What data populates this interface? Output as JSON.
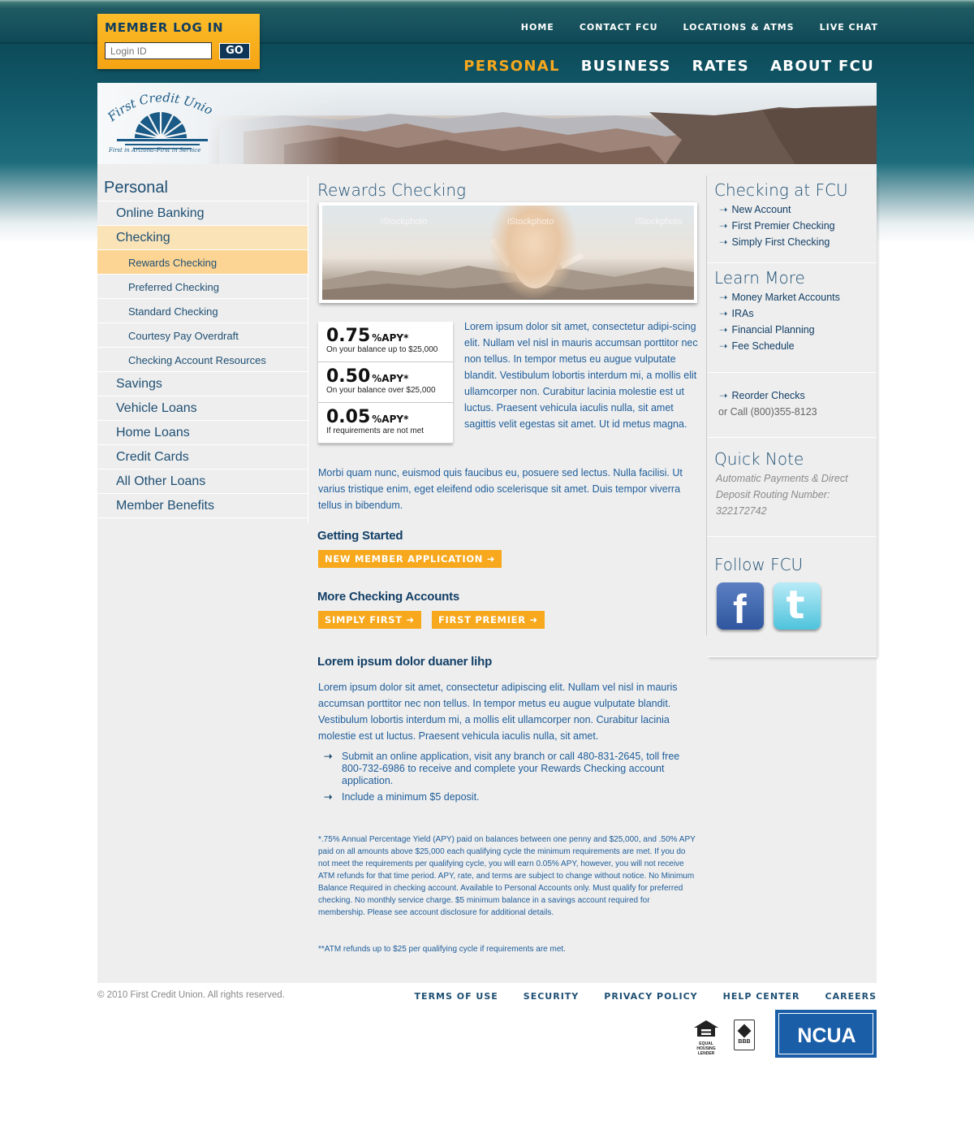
{
  "login": {
    "title": "MEMBER LOG IN",
    "placeholder": "Login ID",
    "go_label": "GO"
  },
  "utility_nav": [
    "HOME",
    "CONTACT FCU",
    "LOCATIONS & ATMS",
    "LIVE CHAT"
  ],
  "main_nav": [
    {
      "label": "PERSONAL",
      "active": true
    },
    {
      "label": "BUSINESS",
      "active": false
    },
    {
      "label": "RATES",
      "active": false
    },
    {
      "label": "ABOUT FCU",
      "active": false
    }
  ],
  "logo": {
    "name": "First Credit Union",
    "tagline": "First in Arizona–First in Service"
  },
  "left_nav": {
    "heading": "Personal",
    "items": [
      {
        "label": "Online Banking",
        "level": 1,
        "active": false
      },
      {
        "label": "Checking",
        "level": 1,
        "active": true
      },
      {
        "label": "Rewards Checking",
        "level": 2,
        "active": true
      },
      {
        "label": "Preferred Checking",
        "level": 2,
        "active": false
      },
      {
        "label": "Standard Checking",
        "level": 2,
        "active": false
      },
      {
        "label": "Courtesy Pay Overdraft",
        "level": 2,
        "active": false
      },
      {
        "label": "Checking Account Resources",
        "level": 2,
        "active": false
      },
      {
        "label": "Savings",
        "level": 1,
        "active": false
      },
      {
        "label": "Vehicle Loans",
        "level": 1,
        "active": false
      },
      {
        "label": "Home Loans",
        "level": 1,
        "active": false
      },
      {
        "label": "Credit Cards",
        "level": 1,
        "active": false
      },
      {
        "label": "All Other Loans",
        "level": 1,
        "active": false
      },
      {
        "label": "Member Benefits",
        "level": 1,
        "active": false
      }
    ]
  },
  "main": {
    "title": "Rewards Checking",
    "hero_watermark": "iStockphoto",
    "rates": [
      {
        "value": "0.75",
        "unit": "%APY*",
        "desc": "On your balance up to $25,000"
      },
      {
        "value": "0.50",
        "unit": "%APY*",
        "desc": "On your balance over $25,000"
      },
      {
        "value": "0.05",
        "unit": "%APY*",
        "desc": "If requirements are not met"
      }
    ],
    "intro": "Lorem ipsum dolor sit amet, consectetur adipi-scing elit. Nullam vel nisl in mauris accumsan porttitor nec non tellus. In tempor metus eu augue vulputate blandit. Vestibulum lobortis interdum mi, a mollis elit ullamcorper non. Curabitur lacinia molestie est ut luctus. Praesent vehicula iaculis nulla, sit amet sagittis velit egestas sit amet. Ut id metus magna.",
    "intro2": "Morbi quam nunc, euismod quis faucibus eu, posuere sed lectus. Nulla facilisi. Ut varius tristique enim, eget eleifend odio scelerisque sit amet. Duis tempor viverra tellus in bibendum.",
    "getting_started": {
      "heading": "Getting Started",
      "button": "NEW MEMBER APPLICATION"
    },
    "more_checking": {
      "heading": "More Checking Accounts",
      "buttons": [
        "SIMPLY FIRST",
        "FIRST PREMIER"
      ]
    },
    "lorem_heading": "Lorem ipsum dolor duaner lihp",
    "lorem_body": "Lorem ipsum dolor sit amet, consectetur adipiscing elit. Nullam vel nisl in mauris accumsan porttitor nec non tellus. In tempor metus eu augue vulputate blandit. Vestibulum lobortis interdum mi, a mollis elit ullamcorper non. Curabitur lacinia molestie est ut luctus. Praesent vehicula iaculis nulla, sit amet.",
    "bullets": [
      "Submit an online application, visit any branch or call 480-831-2645, toll free 800-732-6986 to receive and complete your Rewards Checking account application.",
      "Include a minimum $5 deposit."
    ],
    "fine_print": "*.75% Annual Percentage Yield (APY) paid on balances between one penny and $25,000, and .50% APY paid on all amounts above $25,000 each qualifying cycle the minimum requirements are met. If you do not meet the requirements per qualifying cycle, you will earn 0.05% APY, however, you will not receive ATM refunds for that time period. APY, rate, and terms are subject to change without notice. No Minimum Balance Required in checking account. Available to Personal Accounts only. Must qualify for preferred checking. No monthly service charge. $5 minimum balance in a savings account required for membership. Please see account disclosure for additional details.",
    "fine_print2": "**ATM refunds up to $25 per qualifying cycle if requirements are met."
  },
  "sidebar": {
    "checking": {
      "heading": "Checking at FCU",
      "links": [
        "New Account",
        "First Premier Checking",
        "Simply First Checking"
      ]
    },
    "learn": {
      "heading": "Learn More",
      "links": [
        "Money Market Accounts",
        "IRAs",
        "Financial Planning",
        "Fee Schedule"
      ]
    },
    "reorder": {
      "link": "Reorder Checks",
      "call": "or Call (800)355-8123"
    },
    "quick_note": {
      "heading": "Quick Note",
      "text": "Automatic Payments & Direct Deposit Routing Number: 322172742"
    },
    "follow": {
      "heading": "Follow FCU",
      "facebook_glyph": "f",
      "twitter_glyph": "t"
    }
  },
  "footer": {
    "copyright": "© 2010 First Credit Union. All rights reserved.",
    "links": [
      "TERMS OF USE",
      "SECURITY",
      "PRIVACY POLICY",
      "HELP CENTER",
      "CAREERS"
    ],
    "ehl": "EQUAL HOUSING LENDER",
    "bbb": "BBB",
    "ncua": "NCUA"
  },
  "colors": {
    "accent": "#f7a81c",
    "navy": "#1e4f73",
    "teal": "#0f4957",
    "content_bg": "#eeeeee"
  }
}
